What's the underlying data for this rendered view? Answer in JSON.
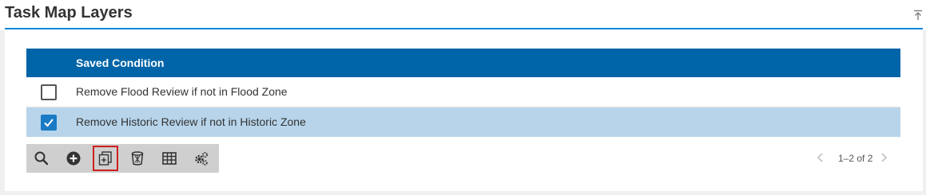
{
  "panel": {
    "title": "Task Map Layers",
    "collapse_icon": "collapse-top-icon"
  },
  "grid": {
    "columns": [
      "Saved Condition"
    ],
    "rows": [
      {
        "label": "Remove Flood Review if not in Flood Zone",
        "checked": false
      },
      {
        "label": "Remove Historic Review if not in Historic Zone",
        "checked": true
      }
    ]
  },
  "toolbar": {
    "buttons": [
      {
        "icon": "search-icon"
      },
      {
        "icon": "add-circle-icon"
      },
      {
        "icon": "copy-add-icon",
        "highlighted": true
      },
      {
        "icon": "trash-icon"
      },
      {
        "icon": "table-icon"
      },
      {
        "icon": "gears-icon"
      }
    ]
  },
  "pager": {
    "text": "1–2 of 2"
  },
  "colors": {
    "header_bg": "#0064a8",
    "selected_row": "#b7d4ea",
    "accent_line": "#0d88d8",
    "highlight_border": "#cc1f1f"
  }
}
